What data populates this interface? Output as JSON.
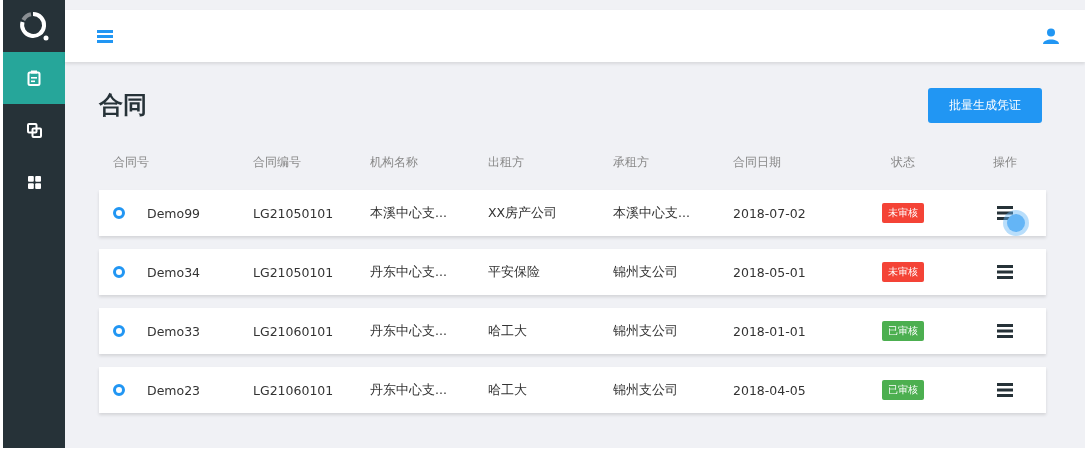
{
  "sidebar": {
    "items": [
      {
        "kind": "clipboard",
        "selected": true
      },
      {
        "kind": "copy",
        "selected": false
      },
      {
        "kind": "grid",
        "selected": false
      }
    ]
  },
  "page": {
    "title": "合同",
    "action_button": "批量生成凭证"
  },
  "table": {
    "columns": [
      "合同号",
      "合同编号",
      "机构名称",
      "出租方",
      "承租方",
      "合同日期",
      "状态",
      "操作"
    ],
    "rows": [
      {
        "contract_no": "Demo99",
        "contract_code": "LG21050101",
        "org": "本溪中心支...",
        "lessor": "XX房产公司",
        "lessee": "本溪中心支...",
        "date": "2018-07-02",
        "status": {
          "kind": "pending",
          "label": "未审核"
        },
        "pressed": true
      },
      {
        "contract_no": "Demo34",
        "contract_code": "LG21050101",
        "org": "丹东中心支...",
        "lessor": "平安保险",
        "lessee": "锦州支公司",
        "date": "2018-05-01",
        "status": {
          "kind": "pending",
          "label": "未审核"
        },
        "pressed": false
      },
      {
        "contract_no": "Demo33",
        "contract_code": "LG21060101",
        "org": "丹东中心支...",
        "lessor": "哈工大",
        "lessee": "锦州支公司",
        "date": "2018-01-01",
        "status": {
          "kind": "approved",
          "label": "已审核"
        },
        "pressed": false
      },
      {
        "contract_no": "Demo23",
        "contract_code": "LG21060101",
        "org": "丹东中心支...",
        "lessor": "哈工大",
        "lessee": "锦州支公司",
        "date": "2018-04-05",
        "status": {
          "kind": "approved",
          "label": "已审核"
        },
        "pressed": false
      }
    ]
  }
}
